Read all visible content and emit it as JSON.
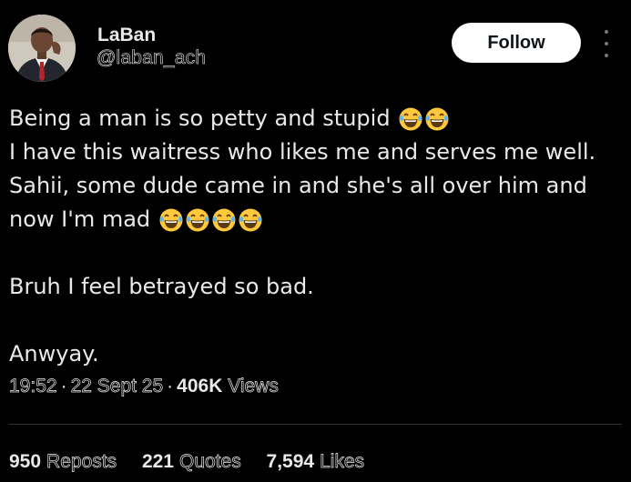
{
  "user": {
    "display_name": "LaBan",
    "handle": "@laban_ach",
    "avatar": "avatar-man-in-suit"
  },
  "actions": {
    "follow_label": "Follow",
    "more_icon": "more-vertical-icon"
  },
  "post": {
    "line1": "Being a man is so petty and stupid",
    "line2": "I have this waitress who likes me and serves me well.",
    "line3": "Sahii, some dude came in and she's all over him and",
    "line4": "now I'm mad",
    "line5": "Bruh I feel betrayed so bad.",
    "line6": "Anwyay.",
    "emoji_icon": "laughing-tears-emoji"
  },
  "meta": {
    "time": "19:52",
    "date": "22 Sept 25",
    "views_count": "406K",
    "views_label": "Views"
  },
  "stats": {
    "reposts_count": "950",
    "reposts_label": "Reposts",
    "quotes_count": "221",
    "quotes_label": "Quotes",
    "likes_count": "7,594",
    "likes_label": "Likes"
  },
  "colors": {
    "background": "#000000",
    "text": "#e7e9ea",
    "secondary": "#71767b",
    "divider": "#2f3336",
    "follow_bg": "#ffffff"
  }
}
